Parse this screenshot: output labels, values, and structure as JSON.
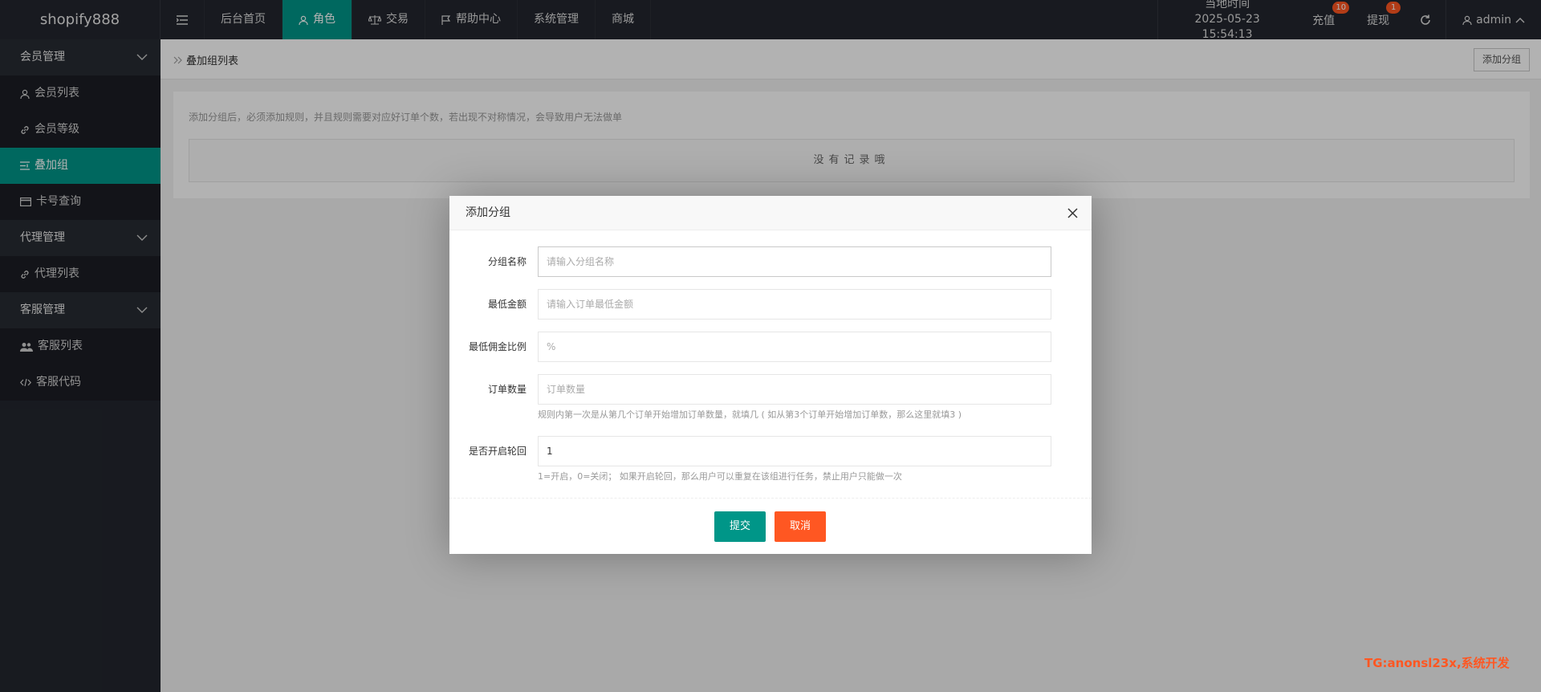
{
  "topbar": {
    "logo": "shopify888",
    "nav": [
      "后台首页",
      "角色",
      "交易",
      "帮助中心",
      "系统管理",
      "商城"
    ],
    "time_label": "当地时间",
    "time_value": "2025-05-23 15:54:13",
    "recharge": "充值",
    "recharge_badge": "10",
    "withdraw": "提现",
    "withdraw_badge": "1",
    "user": "admin"
  },
  "sidebar": {
    "groups": [
      {
        "label": "会员管理",
        "items": [
          "会员列表",
          "会员等级",
          "叠加组",
          "卡号查询"
        ]
      },
      {
        "label": "代理管理",
        "items": [
          "代理列表"
        ]
      },
      {
        "label": "客服管理",
        "items": [
          "客服列表",
          "客服代码"
        ]
      }
    ],
    "active_item": "叠加组"
  },
  "page": {
    "crumb": "叠加组列表",
    "add_button": "添加分组",
    "notice": "添加分组后，必须添加规则，并且规则需要对应好订单个数，若出现不对称情况，会导致用户无法做单",
    "empty": "没有记录哦"
  },
  "modal": {
    "title": "添加分组",
    "fields": [
      {
        "label": "分组名称",
        "placeholder": "请输入分组名称",
        "value": ""
      },
      {
        "label": "最低金额",
        "placeholder": "请输入订单最低金额",
        "value": ""
      },
      {
        "label": "最低佣金比例",
        "placeholder": "%",
        "value": ""
      },
      {
        "label": "订单数量",
        "placeholder": "订单数量",
        "value": "",
        "help": "规则内第一次是从第几个订单开始增加订单数量，就填几 ( 如从第3个订单开始增加订单数，那么这里就填3 )"
      },
      {
        "label": "是否开启轮回",
        "placeholder": "",
        "value": "1",
        "help": "1=开启，0=关闭； 如果开启轮回，那么用户可以重复在该组进行任务，禁止用户只能做一次"
      }
    ],
    "submit": "提交",
    "cancel": "取消"
  },
  "watermark": "TG:anonsl23x,系统开发"
}
